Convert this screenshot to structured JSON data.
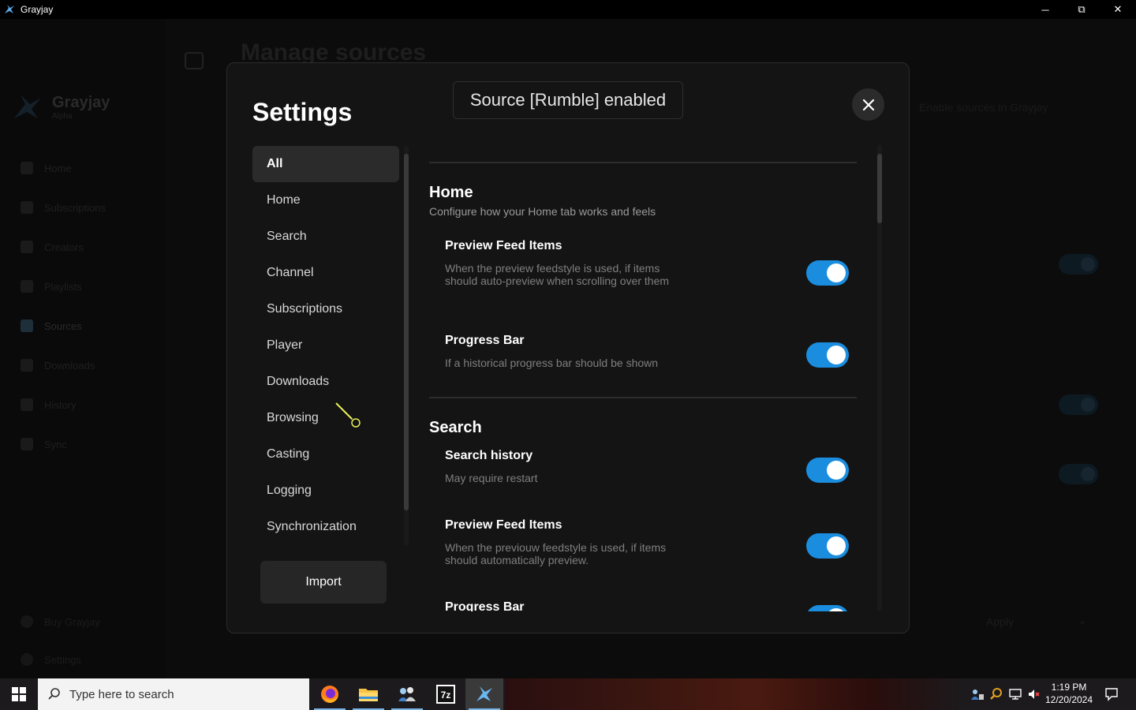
{
  "window": {
    "title": "Grayjay",
    "minimize": "─",
    "maximize": "⧉",
    "close": "✕"
  },
  "background_app": {
    "app_name": "Grayjay",
    "app_sub": "Alpha",
    "heading": "Manage sources",
    "hint": "Enable sources in Grayjay",
    "nav": [
      "Home",
      "Subscriptions",
      "Creators",
      "Playlists",
      "Sources",
      "Downloads",
      "History",
      "Sync"
    ],
    "active_nav_index": 4,
    "bottom_nav": [
      "Buy Grayjay",
      "Settings"
    ],
    "apply_label": "Apply",
    "colors": {
      "toggle": "#0d1a22"
    }
  },
  "settings": {
    "title": "Settings",
    "toast": "Source [Rumble] enabled",
    "menu": [
      "All",
      "Home",
      "Search",
      "Channel",
      "Subscriptions",
      "Player",
      "Downloads",
      "Browsing",
      "Casting",
      "Logging",
      "Synchronization"
    ],
    "active_menu_index": 0,
    "import_label": "Import",
    "sections": {
      "home": {
        "title": "Home",
        "description": "Configure how your Home tab works and feels",
        "preview_feed_items": {
          "title": "Preview Feed Items",
          "description": "When the preview feedstyle is used, if items should auto-preview when scrolling over them",
          "enabled": true
        },
        "progress_bar": {
          "title": "Progress Bar",
          "description": "If a historical progress bar should be shown",
          "enabled": true
        }
      },
      "search": {
        "title": "Search",
        "search_history": {
          "title": "Search history",
          "description": "May require restart",
          "enabled": true
        },
        "preview_feed_items": {
          "title": "Preview Feed Items",
          "description": "When the previouw feedstyle is used, if items should automatically preview.",
          "enabled": true
        },
        "progress_bar": {
          "title": "Progress Bar"
        }
      }
    },
    "colors": {
      "toggle_on": "#1b8ddf",
      "modal_bg": "#141414",
      "active_menu_bg": "#2b2b2b"
    }
  },
  "taskbar": {
    "search_placeholder": "Type here to search",
    "apps": [
      "firefox-icon",
      "file-explorer-icon",
      "people-icon",
      "7zip-icon",
      "grayjay-icon"
    ],
    "active_app_index": 4,
    "tray_icons": [
      "network-people-icon",
      "search-tray-icon",
      "network-icon",
      "volume-muted-icon"
    ],
    "time": "1:19 PM",
    "date": "12/20/2024"
  }
}
